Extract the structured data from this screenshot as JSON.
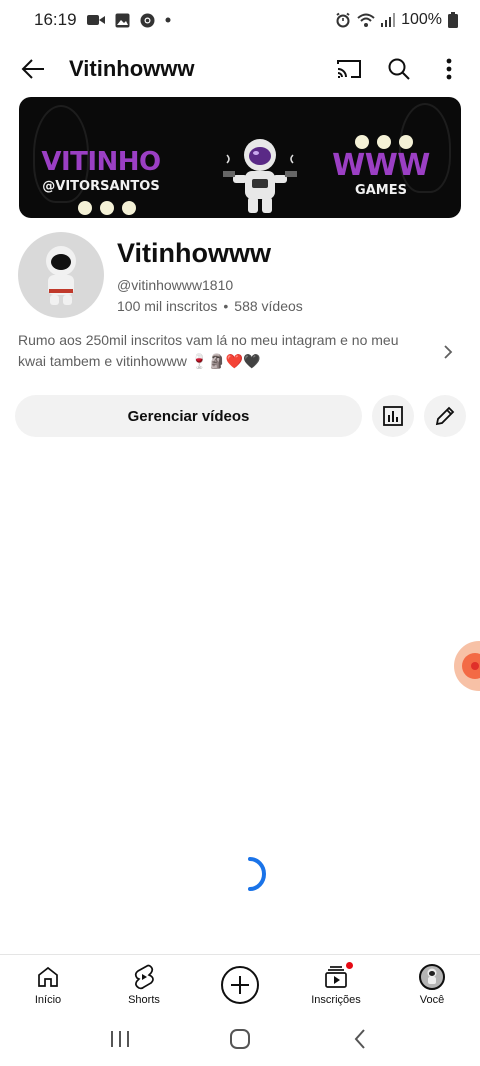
{
  "status_bar": {
    "time": "16:19",
    "battery": "100%",
    "left_icons": [
      "video-call-icon",
      "gallery-icon",
      "chrome-icon",
      "dot-icon"
    ],
    "right_icons": [
      "alarm-icon",
      "wifi-icon",
      "signal-icon",
      "battery-icon"
    ]
  },
  "app_bar": {
    "title": "Vitinhowww",
    "icons": [
      "back-arrow-icon",
      "cast-icon",
      "search-icon",
      "more-vert-icon"
    ]
  },
  "banner": {
    "left_big": "VITINHO",
    "left_small": "@VITORSANTOS",
    "right_big": "WWW",
    "right_small": "GAMES",
    "accent_color": "#9b3fc4"
  },
  "channel": {
    "name": "Vitinhowww",
    "handle": "@vitinhowww1810",
    "subscribers": "100 mil inscritos",
    "separator": "•",
    "videos": "588 vídeos",
    "description": "Rumo aos 250mil inscritos vam lá no meu intagram e  no meu kwai  tambem e vitinhowww 🍷🗿❤️🖤"
  },
  "actions": {
    "manage_label": "Gerenciar vídeos",
    "stats_icon": "analytics-icon",
    "edit_icon": "pencil-icon"
  },
  "bottom_nav": {
    "items": [
      {
        "label": "Início",
        "icon": "home-icon"
      },
      {
        "label": "Shorts",
        "icon": "shorts-icon"
      },
      {
        "label": "",
        "icon": "create-plus-icon"
      },
      {
        "label": "Inscrições",
        "icon": "subscriptions-icon"
      },
      {
        "label": "Você",
        "icon": "you-avatar-icon"
      }
    ]
  },
  "system_nav": [
    "recents-icon",
    "home-circle-icon",
    "back-chevron-icon"
  ]
}
